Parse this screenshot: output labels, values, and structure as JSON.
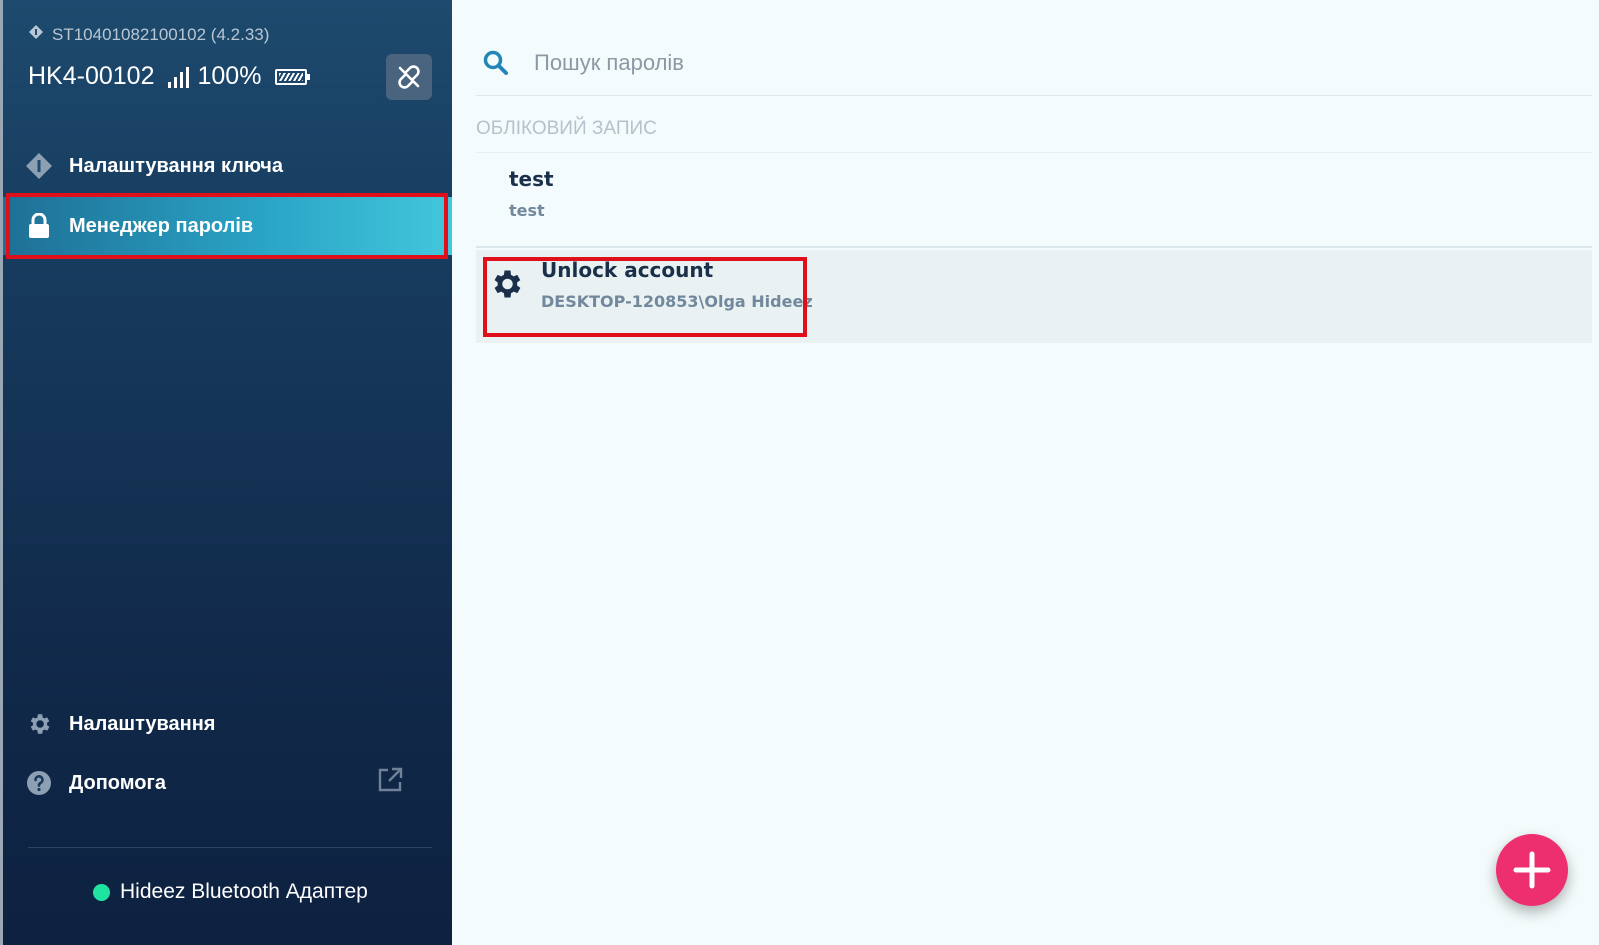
{
  "sidebar": {
    "device_serial": "ST10401082100102 (4.2.33)",
    "device_name": "HK4-00102",
    "signal_level": 4,
    "battery_text": "100%",
    "nav": {
      "key_settings": "Налаштування ключа",
      "password_manager": "Менеджер паролів",
      "settings": "Налаштування",
      "help": "Допомога"
    },
    "adapter_label": "Hideez Bluetooth Адаптер",
    "adapter_status_color": "#1fe4a1"
  },
  "main": {
    "search_placeholder": "Пошук паролів",
    "section_header": "ОБЛІКОВИЙ ЗАПИС",
    "accounts": [
      {
        "title": "test",
        "subtitle": "test",
        "icon": "none"
      },
      {
        "title": "Unlock account",
        "subtitle": "DESKTOP-120853\\Olga Hideez",
        "icon": "gear-icon"
      }
    ],
    "add_button_icon": "plus-icon"
  },
  "colors": {
    "accent": "#2aa6c7",
    "highlight": "#e0101a",
    "fab": "#ee2f6f"
  }
}
